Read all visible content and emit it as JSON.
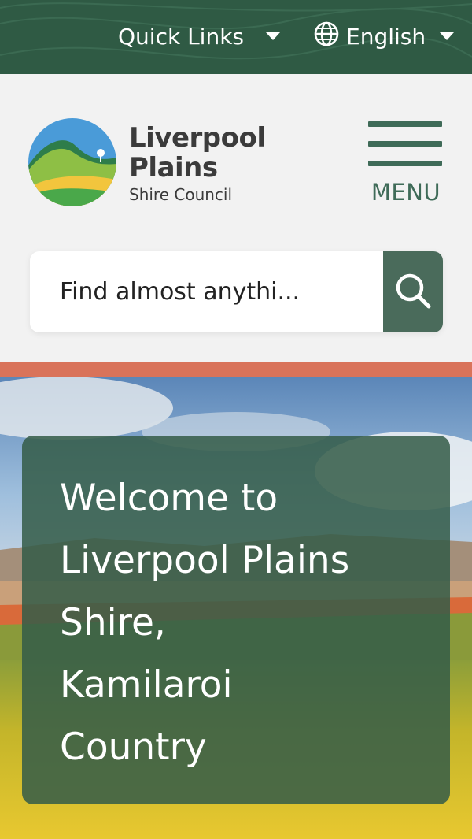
{
  "topbar": {
    "quick_links_label": "Quick Links",
    "language_label": "English",
    "bg_color": "#2f5a44"
  },
  "header": {
    "logo": {
      "line1": "Liverpool",
      "line2": "Plains",
      "line3": "Shire Council"
    },
    "menu_label": "MENU"
  },
  "search": {
    "placeholder": "Find almost anythi...",
    "button_icon": "search-icon"
  },
  "accent_stripe_color": "#d9735a",
  "hero": {
    "heading_lines": [
      "Welcome to",
      "Liverpool Plains",
      "Shire,",
      "Kamilaroi",
      "Country"
    ]
  }
}
